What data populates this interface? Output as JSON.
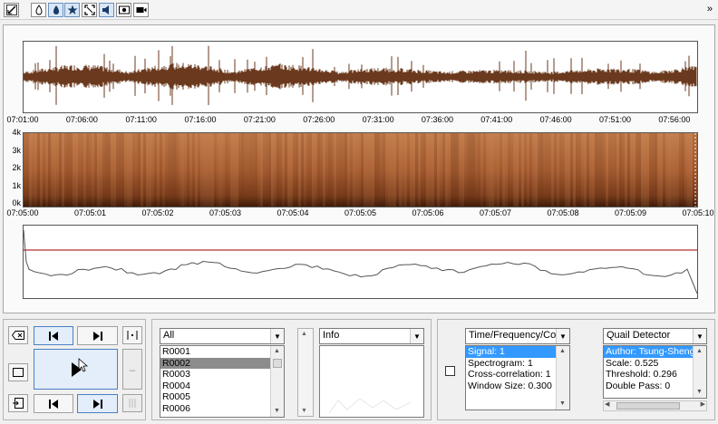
{
  "toolbar": {
    "buttons": [
      {
        "icon": "resize-diagonal-icon",
        "active": false
      },
      {
        "icon": "drop-icon",
        "active": false
      },
      {
        "icon": "drop-filled-icon",
        "active": true
      },
      {
        "icon": "star-icon",
        "active": true
      },
      {
        "icon": "fullscreen-icon",
        "active": false
      },
      {
        "icon": "speaker-icon",
        "active": true
      },
      {
        "icon": "screenshot-icon",
        "active": false
      },
      {
        "icon": "video-camera-icon",
        "active": false
      }
    ],
    "expand_icon": "chevron-double-right-icon"
  },
  "colors": {
    "waveform": "#6b3a1e",
    "spectrogram_base": "#b06a3c",
    "threshold_line": "#b03030",
    "detector_line": "#555555",
    "selection": "#3399ff"
  },
  "waveform": {
    "x_ticks": [
      "07:01:00",
      "07:06:00",
      "07:11:00",
      "07:16:00",
      "07:21:00",
      "07:26:00",
      "07:31:00",
      "07:36:00",
      "07:41:00",
      "07:46:00",
      "07:51:00",
      "07:56:00"
    ]
  },
  "spectrogram": {
    "y_ticks": [
      "4k",
      "3k",
      "2k",
      "1k",
      "0k"
    ],
    "x_ticks": [
      "07:05:00",
      "07:05:01",
      "07:05:02",
      "07:05:03",
      "07:05:04",
      "07:05:05",
      "07:05:06",
      "07:05:07",
      "07:05:08",
      "07:05:09",
      "07:05:10"
    ]
  },
  "detector_plot": {
    "threshold": 0.296
  },
  "playback": {
    "icons": [
      "erase-icon",
      "step-back-icon",
      "step-forward-icon",
      "mark-segment-icon",
      "stop-square-icon",
      "play-icon",
      "minus-icon",
      "export-icon",
      "skip-start-icon",
      "skip-end-icon",
      "split-icon"
    ]
  },
  "recordings": {
    "filter": "All",
    "items": [
      "R0001",
      "R0002",
      "R0003",
      "R0004",
      "R0005",
      "R0006"
    ],
    "selected_index": 1
  },
  "info": {
    "dropdown": "Info"
  },
  "display": {
    "dropdown": "Time/Frequency/Co...",
    "items": [
      "Signal: 1",
      "Spectrogram: 1",
      "Cross-correlation: 1",
      "Window Size: 0.300"
    ],
    "selected_index": 0
  },
  "detector": {
    "dropdown": "Quail Detector",
    "items": [
      "Author: Tsung-Sheng",
      "Scale: 0.525",
      "Threshold: 0.296",
      "Double Pass: 0"
    ],
    "selected_index": 0
  }
}
